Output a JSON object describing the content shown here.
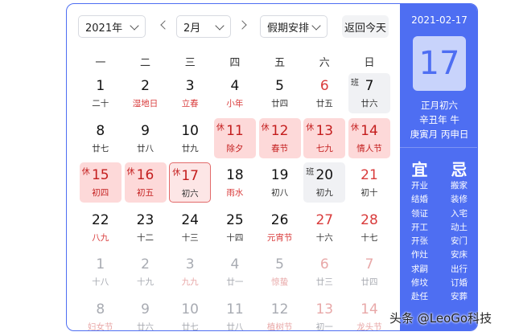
{
  "toolbar": {
    "year": "2021年",
    "month": "2月",
    "holiday_select": "假期安排",
    "today_button": "返回今天"
  },
  "weekdays": [
    "一",
    "二",
    "三",
    "四",
    "五",
    "六",
    "日"
  ],
  "weeks": [
    [
      {
        "day": "1",
        "sub": "二十"
      },
      {
        "day": "2",
        "sub": "湿地日",
        "sub_red": true
      },
      {
        "day": "3",
        "sub": "立春",
        "sub_red": true
      },
      {
        "day": "4",
        "sub": "小年",
        "sub_red": true
      },
      {
        "day": "5",
        "sub": "廿四"
      },
      {
        "day": "6",
        "sub": "廿五",
        "weekend": true
      },
      {
        "day": "7",
        "sub": "廿六",
        "tag": "班",
        "type": "workday"
      }
    ],
    [
      {
        "day": "8",
        "sub": "廿七"
      },
      {
        "day": "9",
        "sub": "廿八"
      },
      {
        "day": "10",
        "sub": "廿九"
      },
      {
        "day": "11",
        "sub": "除夕",
        "tag": "休",
        "type": "holiday"
      },
      {
        "day": "12",
        "sub": "春节",
        "tag": "休",
        "type": "holiday"
      },
      {
        "day": "13",
        "sub": "七九",
        "tag": "休",
        "type": "holiday"
      },
      {
        "day": "14",
        "sub": "情人节",
        "tag": "休",
        "type": "holiday"
      }
    ],
    [
      {
        "day": "15",
        "sub": "初四",
        "tag": "休",
        "type": "holiday"
      },
      {
        "day": "16",
        "sub": "初五",
        "tag": "休",
        "type": "holiday"
      },
      {
        "day": "17",
        "sub": "初六",
        "tag": "休",
        "type": "today"
      },
      {
        "day": "18",
        "sub": "雨水",
        "sub_red": true
      },
      {
        "day": "19",
        "sub": "初八"
      },
      {
        "day": "20",
        "sub": "初九",
        "tag": "班",
        "type": "workday"
      },
      {
        "day": "21",
        "sub": "初十",
        "weekend": true
      }
    ],
    [
      {
        "day": "22",
        "sub": "八九",
        "sub_red": true
      },
      {
        "day": "23",
        "sub": "十二"
      },
      {
        "day": "24",
        "sub": "十三"
      },
      {
        "day": "25",
        "sub": "十四"
      },
      {
        "day": "26",
        "sub": "元宵节",
        "sub_red": true
      },
      {
        "day": "27",
        "sub": "十六",
        "weekend": true
      },
      {
        "day": "28",
        "sub": "十七",
        "weekend": true
      }
    ],
    [
      {
        "day": "1",
        "sub": "十八",
        "other": true
      },
      {
        "day": "2",
        "sub": "十九",
        "other": true
      },
      {
        "day": "3",
        "sub": "九九",
        "sub_red": true,
        "other": true
      },
      {
        "day": "4",
        "sub": "廿一",
        "other": true
      },
      {
        "day": "5",
        "sub": "惊蛰",
        "sub_red": true,
        "other": true
      },
      {
        "day": "6",
        "sub": "廿三",
        "weekend": true,
        "other": true
      },
      {
        "day": "7",
        "sub": "廿四",
        "weekend": true,
        "other": true
      }
    ],
    [
      {
        "day": "8",
        "sub": "妇女节",
        "sub_red": true,
        "other": true
      },
      {
        "day": "9",
        "sub": "廿六",
        "other": true
      },
      {
        "day": "10",
        "sub": "廿七",
        "other": true
      },
      {
        "day": "11",
        "sub": "廿八",
        "other": true
      },
      {
        "day": "12",
        "sub": "植树节",
        "sub_red": true,
        "other": true
      },
      {
        "day": "13",
        "sub": "初一",
        "weekend": true,
        "other": true
      },
      {
        "day": "14",
        "sub": "龙头节",
        "sub_red": true,
        "weekend": true,
        "other": true
      }
    ]
  ],
  "panel": {
    "date": "2021-02-17",
    "day": "17",
    "lunar_line1": "正月初六",
    "lunar_line2": "辛丑年 牛",
    "lunar_line3": "庚寅月 丙申日",
    "yi_title": "宜",
    "ji_title": "忌",
    "yi": [
      "开业",
      "结婚",
      "领证",
      "开工",
      "开张",
      "作灶",
      "求嗣",
      "修坟",
      "赴任"
    ],
    "ji": [
      "搬家",
      "装修",
      "入宅",
      "动土",
      "安门",
      "安床",
      "出行",
      "订婚",
      "安葬"
    ]
  },
  "watermark": "头条 @LeoGo科技",
  "colors": {
    "accent": "#4e6ef2",
    "holiday_bg": "#fdd9d9",
    "holiday_text": "#c41e1e"
  }
}
